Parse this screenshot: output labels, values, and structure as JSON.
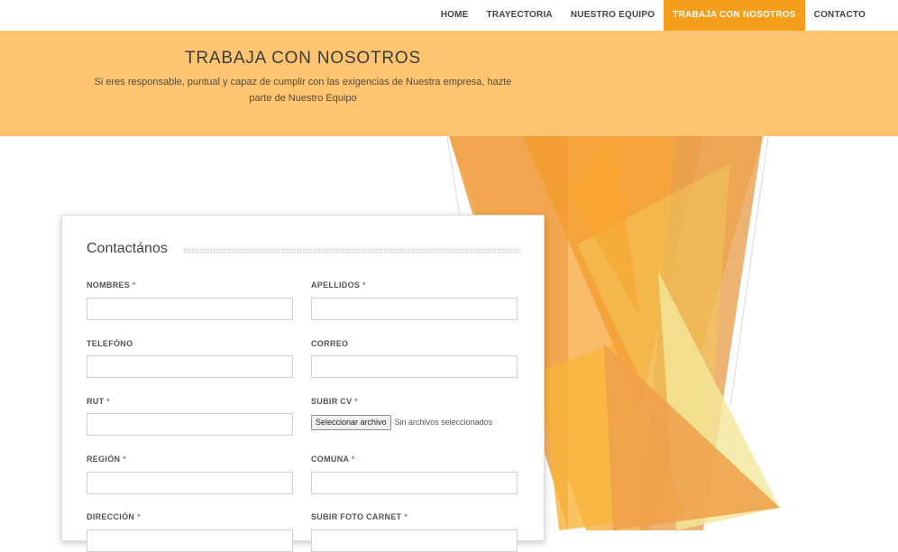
{
  "nav": {
    "items": [
      {
        "label": "HOME"
      },
      {
        "label": "TRAYECTORIA"
      },
      {
        "label": "NUESTRO EQUIPO"
      },
      {
        "label": "TRABAJA CON NOSOTROS",
        "active": true
      },
      {
        "label": "CONTACTO"
      }
    ],
    "active_color": "#f49e1c"
  },
  "hero": {
    "title": "TRABAJA CON NOSOTROS",
    "subtitle": "Si eres responsable, puntual y capaz de cumplir con las exigencias de Nuestra empresa, hazte parte de Nuestro Equipo",
    "background": "#fdc571"
  },
  "form": {
    "title": "Contactános",
    "required_marker": "*",
    "fields": {
      "nombres": {
        "label": "NOMBRES",
        "value": ""
      },
      "apellidos": {
        "label": "APELLIDOS",
        "value": ""
      },
      "telefono": {
        "label": "TELEFÓNO",
        "value": ""
      },
      "correo": {
        "label": "CORREO",
        "value": ""
      },
      "rut": {
        "label": "RUT",
        "value": ""
      },
      "subir_cv": {
        "label": "SUBIR CV",
        "button": "Seleccionar archivo",
        "status": "Sin archivos seleccionados"
      },
      "region": {
        "label": "REGIÓN",
        "value": ""
      },
      "comuna": {
        "label": "COMUNA",
        "value": ""
      },
      "direccion": {
        "label": "DIRECCIÓN",
        "value": ""
      },
      "foto_carnet": {
        "label": "SUBIR FOTO CARNET"
      }
    }
  }
}
